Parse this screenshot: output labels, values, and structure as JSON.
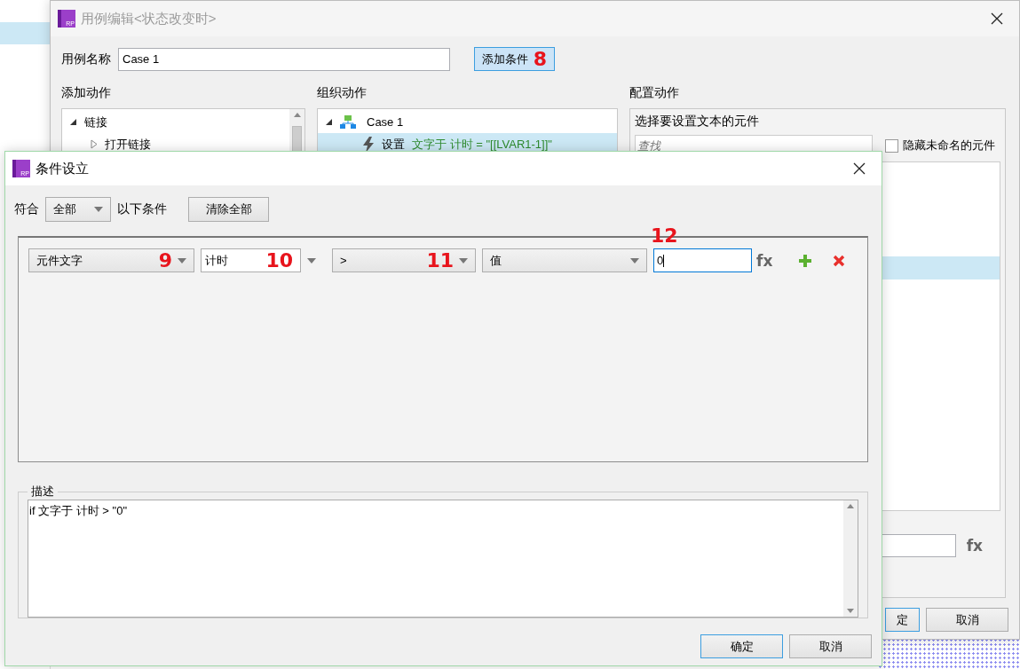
{
  "case_editor": {
    "logo_text": "RP",
    "title": "用例编辑<状态改变时>",
    "case_name_label": "用例名称",
    "case_name": "Case 1",
    "add_condition_button": "添加条件",
    "add_condition_annotation": "8",
    "add_actions": {
      "heading": "添加动作",
      "tree": [
        {
          "label": "链接",
          "expanded": true,
          "children": [
            {
              "label": "打开链接",
              "expanded": false
            }
          ]
        }
      ]
    },
    "organize_actions": {
      "heading": "组织动作",
      "tree": [
        {
          "label": "Case 1",
          "expanded": true,
          "children": [
            {
              "verb": "设置",
              "detail": "文字于 计时 = \"[[LVAR1-1]]\"",
              "selected": true
            }
          ]
        }
      ]
    },
    "configure_actions": {
      "heading": "配置动作",
      "prompt": "选择要设置文本的元件",
      "search": {
        "placeholder": "查找"
      },
      "hide_unnamed": {
        "label": "隐藏未命名的元件",
        "checked": false
      },
      "fx": "fx"
    },
    "buttons": [
      {
        "label": "定",
        "default": true
      },
      {
        "label": "取消",
        "default": false
      }
    ]
  },
  "condition_dialog": {
    "logo_text": "RP",
    "title": "条件设立",
    "match_label": "符合",
    "match_select": "全部",
    "match_suffix": "以下条件",
    "clear_button": "清除全部",
    "conditions": [
      {
        "fields": [
          {
            "kind": "select",
            "value": "元件文字",
            "annotation": "9"
          },
          {
            "kind": "combo",
            "value": "计时",
            "annotation": "10"
          },
          {
            "kind": "select",
            "value": ">",
            "annotation": "11"
          },
          {
            "kind": "select",
            "value": "值"
          },
          {
            "kind": "input",
            "value": "0",
            "annotation": "12",
            "focused": true
          }
        ],
        "fx": "fx"
      }
    ],
    "description_label": "描述",
    "description": "if 文字于 计时 > \"0\"",
    "buttons": [
      {
        "label": "确定",
        "default": true
      },
      {
        "label": "取消",
        "default": false
      }
    ]
  }
}
